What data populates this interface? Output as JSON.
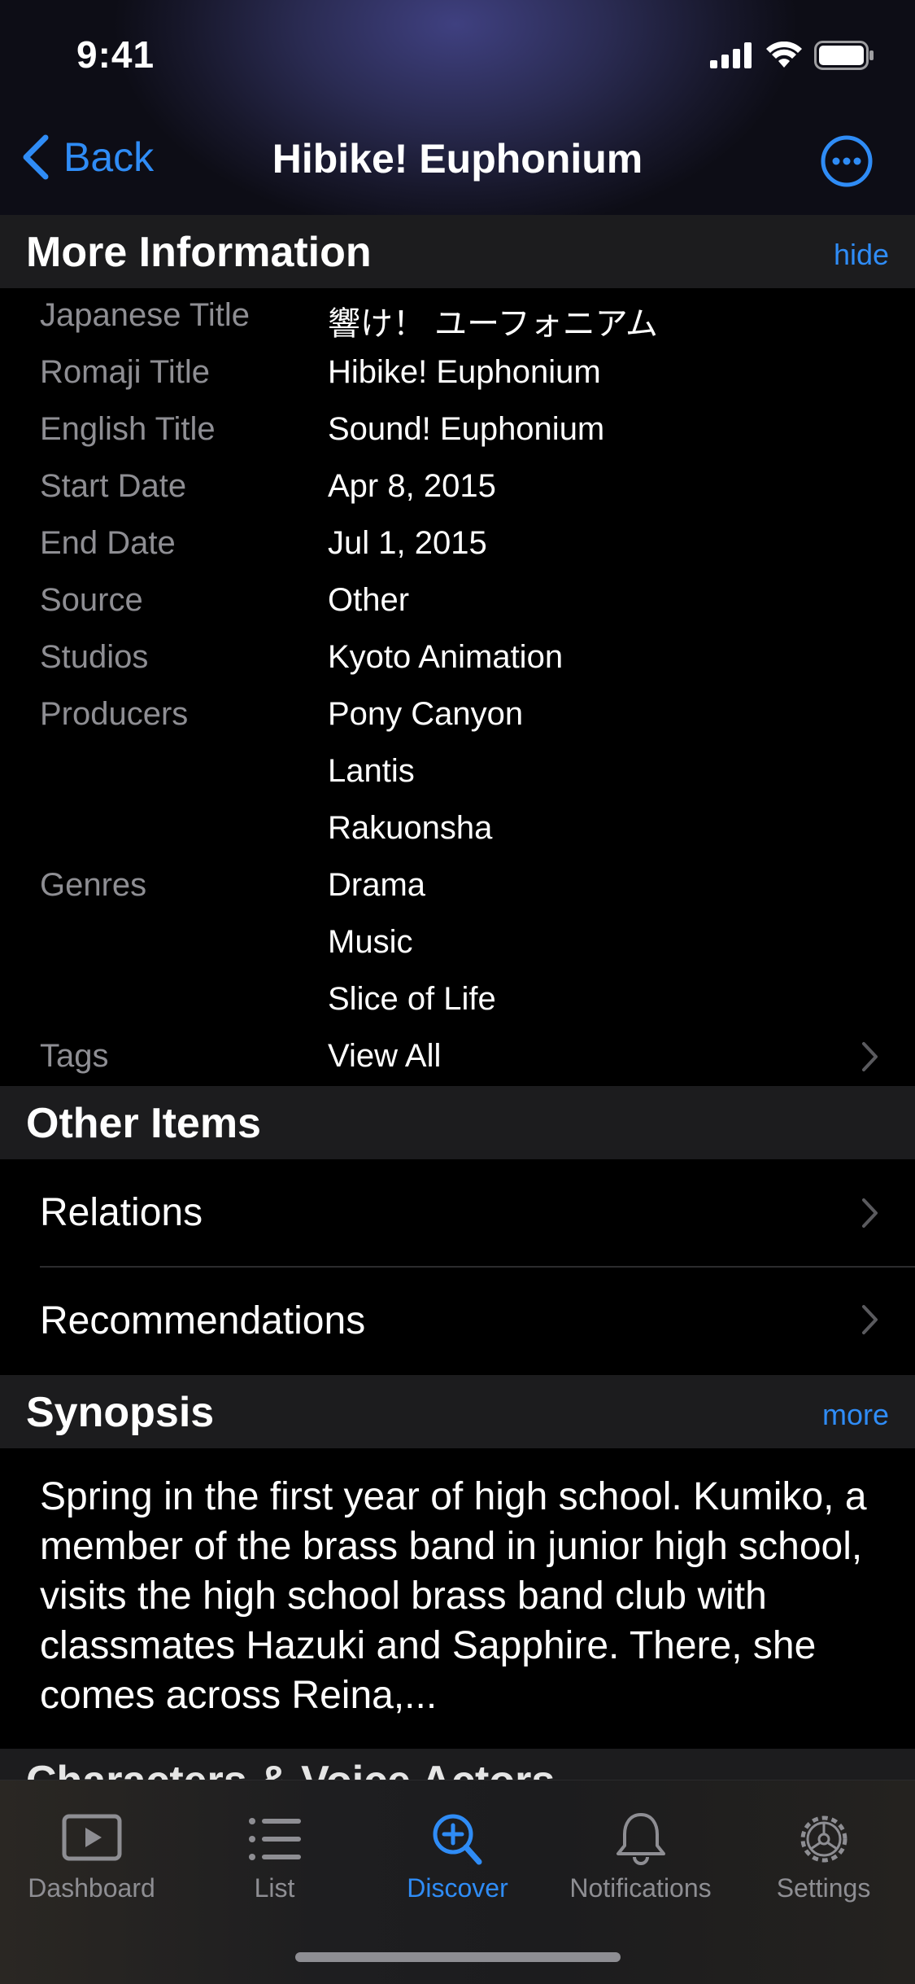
{
  "status": {
    "time": "9:41"
  },
  "nav": {
    "back_label": "Back",
    "title": "Hibike! Euphonium"
  },
  "more_info": {
    "title": "More Information",
    "action": "hide",
    "rows": [
      {
        "label": "Japanese Title",
        "value": "響け！ ユーフォニアム"
      },
      {
        "label": "Romaji Title",
        "value": "Hibike! Euphonium"
      },
      {
        "label": "English Title",
        "value": "Sound! Euphonium"
      },
      {
        "label": "Start Date",
        "value": "Apr 8, 2015"
      },
      {
        "label": "End Date",
        "value": "Jul 1, 2015"
      },
      {
        "label": "Source",
        "value": "Other"
      },
      {
        "label": "Studios",
        "value": "Kyoto Animation"
      },
      {
        "label": "Producers",
        "value": "Pony Canyon"
      },
      {
        "label": "",
        "value": "Lantis"
      },
      {
        "label": "",
        "value": "Rakuonsha"
      },
      {
        "label": "Genres",
        "value": "Drama"
      },
      {
        "label": "",
        "value": "Music"
      },
      {
        "label": "",
        "value": "Slice of Life"
      },
      {
        "label": "Tags",
        "value": "View All"
      }
    ]
  },
  "other_items": {
    "title": "Other Items",
    "items": [
      {
        "label": "Relations"
      },
      {
        "label": "Recommendations"
      }
    ]
  },
  "synopsis": {
    "title": "Synopsis",
    "action": "more",
    "text": "Spring in the first year of high school. Kumiko, a member of the brass band in junior high school, visits the high school brass band club with classmates Hazuki and Sapphire. There, she comes across Reina,..."
  },
  "next_section": {
    "title": "Characters & Voice Actors"
  },
  "tabbar": {
    "tabs": [
      {
        "label": "Dashboard",
        "icon": "play-icon"
      },
      {
        "label": "List",
        "icon": "list-icon"
      },
      {
        "label": "Discover",
        "icon": "magnifier-plus-icon",
        "active": true
      },
      {
        "label": "Notifications",
        "icon": "bell-icon"
      },
      {
        "label": "Settings",
        "icon": "gear-icon"
      }
    ]
  },
  "colors": {
    "accent": "#2f8cf6",
    "label_gray": "#8e8e93",
    "section_bg": "#1c1c1e"
  }
}
